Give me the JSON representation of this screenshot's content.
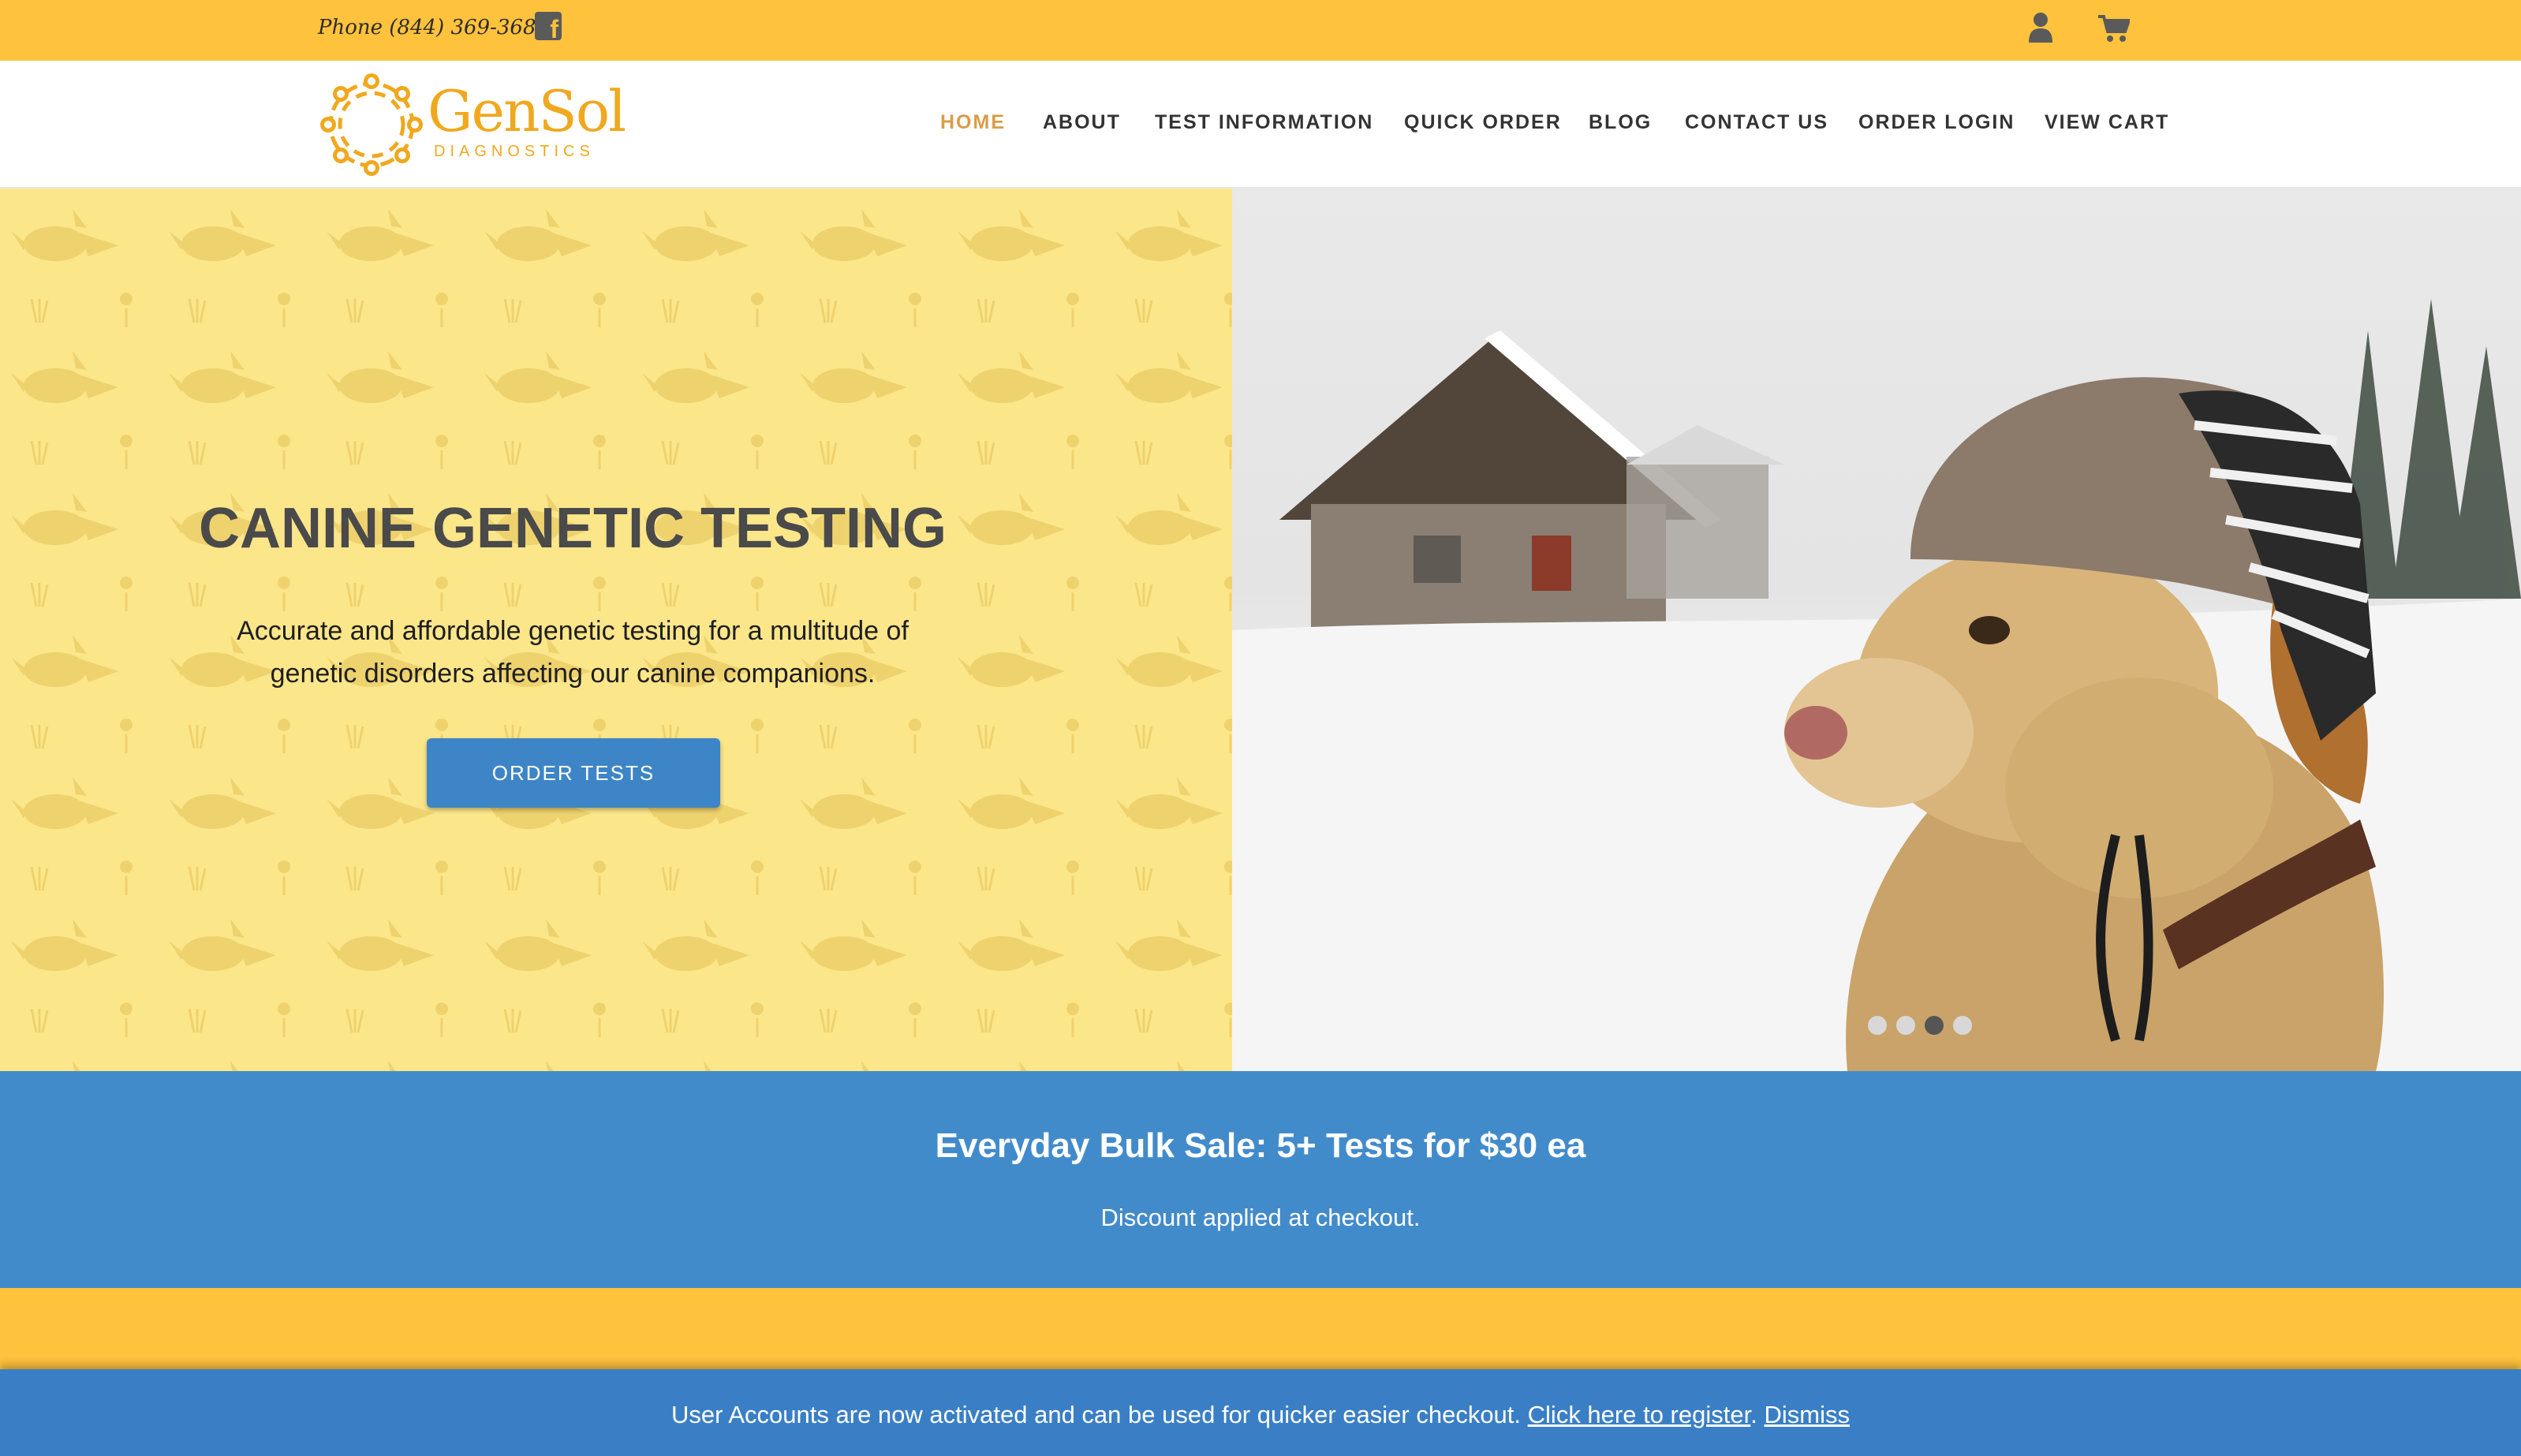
{
  "topbar": {
    "phone": "Phone (844) 369-3686",
    "facebook_icon": "facebook-square-icon",
    "user_icon": "user-icon",
    "cart_icon": "shopping-cart-icon",
    "color": "#ffc23c"
  },
  "header": {
    "logo_name": "GenSol",
    "logo_sub": "DIAGNOSTICS",
    "nav": [
      {
        "label": "HOME",
        "active": true
      },
      {
        "label": "ABOUT",
        "active": false
      },
      {
        "label": "TEST INFORMATION",
        "active": false
      },
      {
        "label": "QUICK ORDER",
        "active": false
      },
      {
        "label": "BLOG",
        "active": false
      },
      {
        "label": "CONTACT US",
        "active": false
      },
      {
        "label": "ORDER LOGIN",
        "active": false
      },
      {
        "label": "VIEW CART",
        "active": false
      }
    ],
    "active_color": "#d99c47"
  },
  "hero": {
    "title": "CANINE GENETIC TESTING",
    "subtitle": "Accurate and affordable genetic testing for a multitude of genetic disorders affecting our canine companions.",
    "button": "ORDER TESTS",
    "button_color": "#3d85c6",
    "slides_count": 4,
    "active_slide": 3
  },
  "sale": {
    "title": "Everyday Bulk Sale: 5+ Tests for $30 ea",
    "note": "Discount applied at checkout.",
    "color": "#428bcb"
  },
  "notice": {
    "text": "User Accounts are now activated and can be used for quicker easier checkout.",
    "register_link": "Click here to register",
    "separator": ".",
    "dismiss_link": "Dismiss"
  }
}
